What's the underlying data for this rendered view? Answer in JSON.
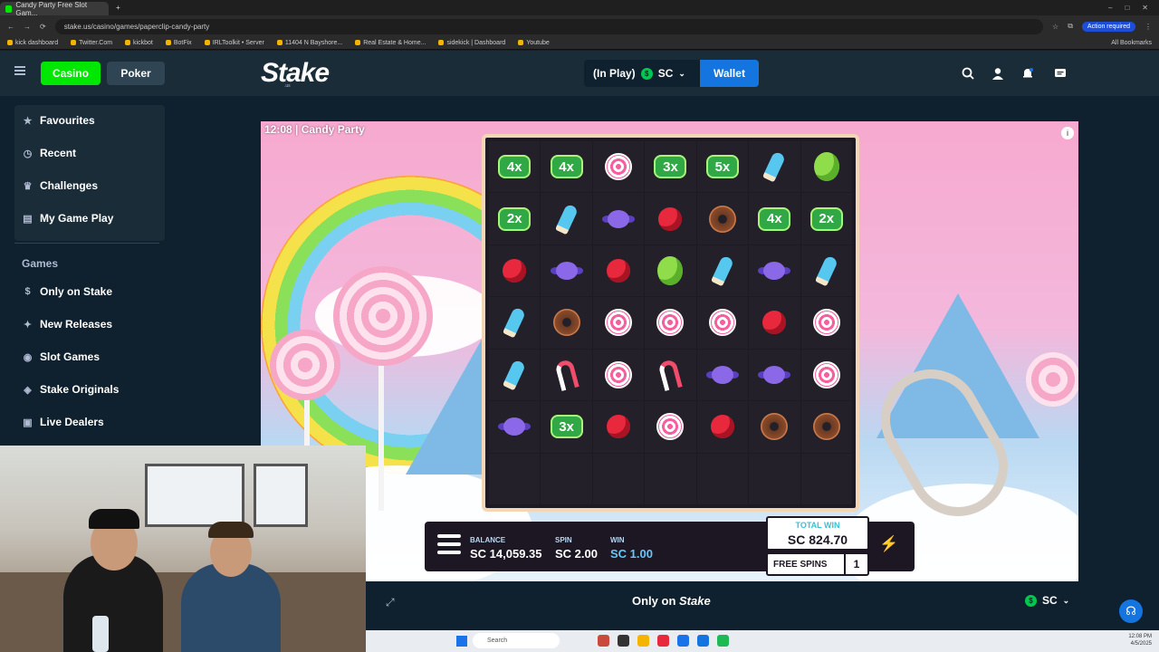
{
  "browser": {
    "tab_title": "Candy Party Free Slot Gam...",
    "url": "stake.us/casino/games/paperclip-candy-party",
    "action_required": "Action required",
    "bookmarks": [
      "kick dashboard",
      "Twitter.Com",
      "kickbot",
      "BotFix",
      "IRLToolkit • Server",
      "11404 N Bayshore...",
      "Real Estate & Home...",
      "sidekick | Dashboard",
      "Youtube"
    ],
    "all_bookmarks": "All Bookmarks"
  },
  "header": {
    "casino_label": "Casino",
    "poker_label": "Poker",
    "logo": "Stake",
    "logo_sub": ".us",
    "balance_status": "(In Play)",
    "currency": "SC",
    "currency_coin": "$",
    "wallet_label": "Wallet"
  },
  "sidebar": {
    "top_items": [
      {
        "label": "Favourites",
        "icon": "star-icon"
      },
      {
        "label": "Recent",
        "icon": "clock-icon"
      },
      {
        "label": "Challenges",
        "icon": "trophy-icon"
      },
      {
        "label": "My Game Play",
        "icon": "history-icon"
      }
    ],
    "games_heading": "Games",
    "game_items": [
      {
        "label": "Only on Stake",
        "icon": "stake-icon"
      },
      {
        "label": "New Releases",
        "icon": "sparkle-icon"
      },
      {
        "label": "Slot Games",
        "icon": "slot-icon"
      },
      {
        "label": "Stake Originals",
        "icon": "originals-icon"
      },
      {
        "label": "Live Dealers",
        "icon": "live-icon"
      }
    ]
  },
  "game": {
    "title": "12:08 | Candy Party",
    "grid": [
      [
        "4x",
        "4x",
        "lollipop",
        "3x",
        "5x",
        "icepop",
        "gum"
      ],
      [
        "2x",
        "icepop",
        "wrapped",
        "apple",
        "donut",
        "4x",
        "2x"
      ],
      [
        "apple",
        "wrapped",
        "apple",
        "gum",
        "icepop",
        "wrapped",
        "icepop"
      ],
      [
        "icepop",
        "donut",
        "lollipop",
        "lollipop",
        "lollipop",
        "apple",
        "lollipop"
      ],
      [
        "icepop",
        "cane",
        "lollipop",
        "cane",
        "wrapped",
        "wrapped",
        "lollipop"
      ],
      [
        "wrapped",
        "3x",
        "apple",
        "lollipop",
        "apple",
        "donut",
        "donut"
      ],
      [
        "",
        "",
        "",
        "",
        "",
        "",
        ""
      ]
    ],
    "balance_label": "BALANCE",
    "balance_value": "SC 14,059.35",
    "spin_label": "SPIN",
    "spin_value": "SC 2.00",
    "win_label": "WIN",
    "win_value": "SC 1.00",
    "total_win_label": "TOTAL WIN",
    "total_win_value": "SC 824.70",
    "free_spins_label": "FREE SPINS",
    "free_spins_count": "1",
    "turbo_icon": "lightning-icon"
  },
  "footer": {
    "only_on": "Only on",
    "brand": "Stake",
    "currency": "SC"
  },
  "taskbar": {
    "search_placeholder": "Search",
    "time": "12:08 PM",
    "date": "4/5/2025"
  },
  "colors": {
    "green": "#00e701",
    "blue": "#1475e1",
    "bg_dark": "#0f212e",
    "panel": "#1a2c38"
  }
}
